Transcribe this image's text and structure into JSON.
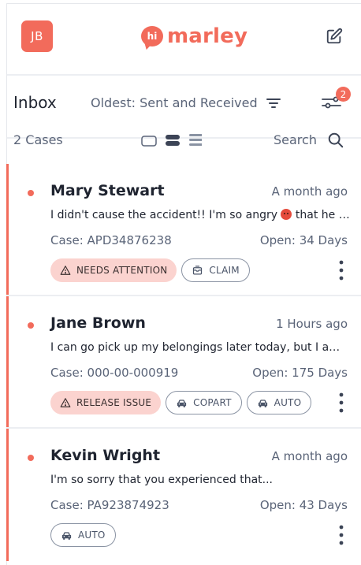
{
  "header": {
    "avatar_initials": "JB",
    "logo_bubble": "hi",
    "logo_text": "marley",
    "compose_icon": "compose-icon"
  },
  "inbox": {
    "title": "Inbox",
    "sort_label": "Oldest: Sent and Received",
    "filter_badge": "2",
    "cases_count": "2 Cases",
    "search_label": "Search"
  },
  "cases": [
    {
      "name": "Mary Stewart",
      "time": "A month ago",
      "preview_before": "I didn't cause the accident!! I'm so angry ",
      "preview_after": " that he h...",
      "case_id": "Case: APD34876238",
      "open_days": "Open: 34 Days",
      "tags": [
        "NEEDS ATTENTION",
        "CLAIM"
      ]
    },
    {
      "name": "Jane Brown",
      "time": "1 Hours ago",
      "preview_before": "I can go pick up my belongings later today, but I am...",
      "preview_after": "",
      "case_id": "Case: 000-00-000919",
      "open_days": "Open: 175 Days",
      "tags": [
        "RELEASE ISSUE",
        "COPART",
        "AUTO"
      ]
    },
    {
      "name": "Kevin Wright",
      "time": "A month ago",
      "preview_before": "I'm so sorry that you experienced that...",
      "preview_after": "",
      "case_id": "Case: PA923874923",
      "open_days": "Open: 43 Days",
      "tags": [
        "AUTO"
      ]
    }
  ],
  "colors": {
    "brand": "#f26b5b",
    "alert_tag_bg": "#fbd3cf",
    "muted_text": "#5a6478"
  }
}
